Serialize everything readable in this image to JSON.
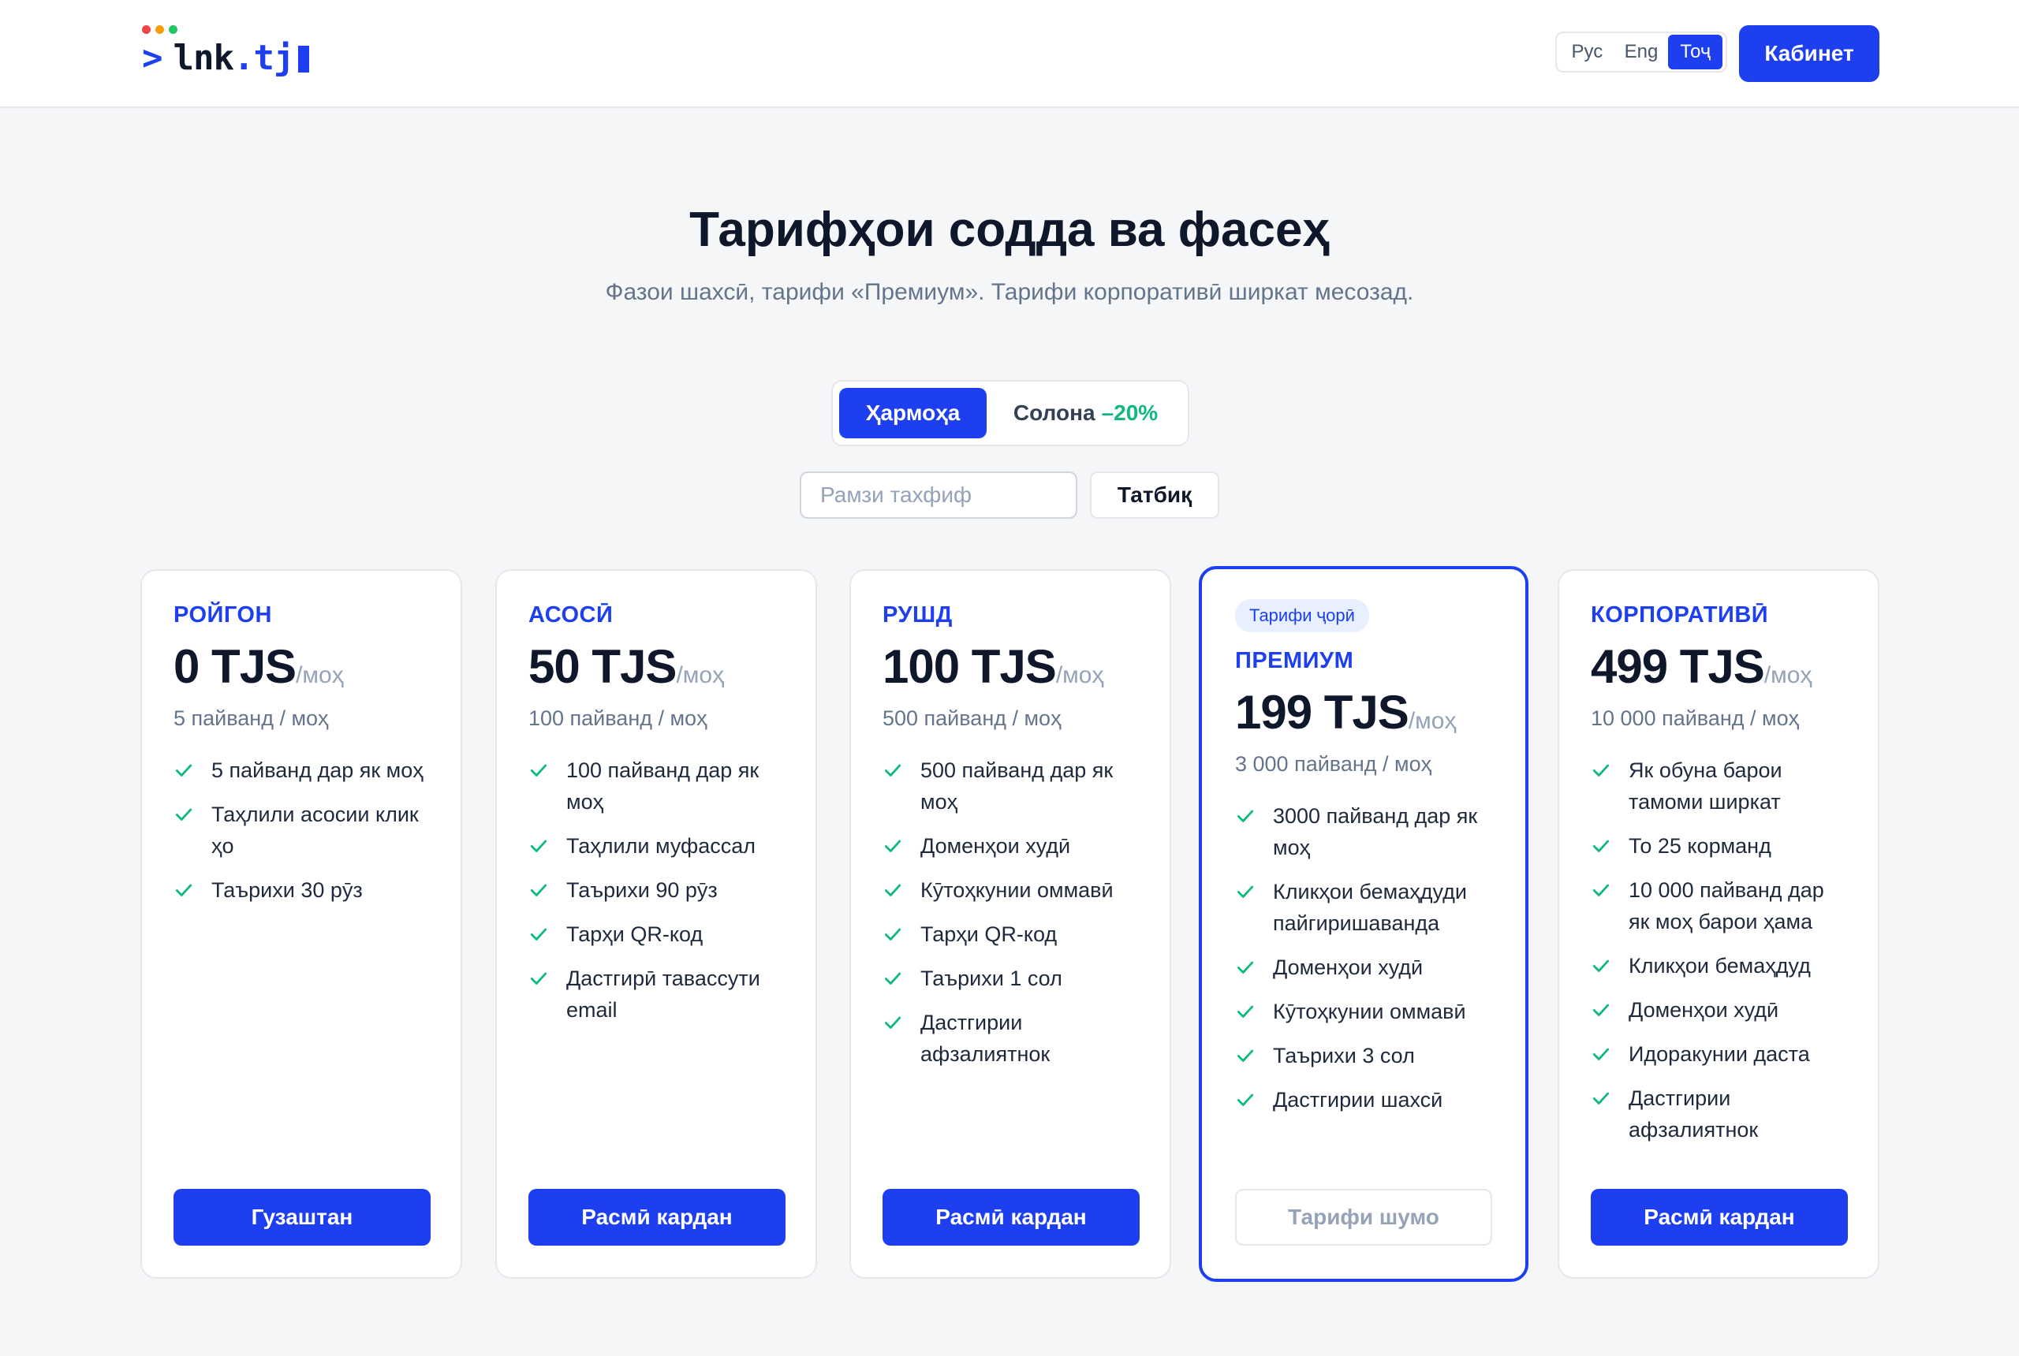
{
  "header": {
    "logo": {
      "prompt": ">",
      "name": "lnk",
      "dot": ".",
      "tld": "tj"
    },
    "languages": [
      {
        "label": "Рус",
        "active": false
      },
      {
        "label": "Eng",
        "active": false
      },
      {
        "label": "Тоҷ",
        "active": true
      }
    ],
    "cabinet_label": "Кабинет"
  },
  "hero": {
    "title": "Тарифҳои содда ва фасеҳ",
    "subtitle": "Фазои шахсӣ, тарифи «Премиум». Тарифи корпоративӣ ширкат месозад."
  },
  "billing": {
    "monthly_label": "Ҳармоҳа",
    "yearly_label": "Солона",
    "yearly_discount": "–20%"
  },
  "promo": {
    "placeholder": "Рамзи тахфиф",
    "apply_label": "Татбиқ"
  },
  "plans": [
    {
      "name": "РОЙГОН",
      "price": "0 TJS",
      "per": "/моҳ",
      "links": "5 пайванд / моҳ",
      "features": [
        "5 пайванд дар як моҳ",
        "Таҳлили асосии клик​ҳо",
        "Таърихи 30 рӯз"
      ],
      "button": "Гузаштан"
    },
    {
      "name": "АСОСӢ",
      "price": "50 TJS",
      "per": "/моҳ",
      "links": "100 пайванд / моҳ",
      "features": [
        "100 пайванд дар як моҳ",
        "Таҳлили муфассал",
        "Таърихи 90 рӯз",
        "Тарҳи QR-код",
        "Дастгирӣ тавассути email"
      ],
      "button": "Расмӣ кардан"
    },
    {
      "name": "РУШД",
      "price": "100 TJS",
      "per": "/моҳ",
      "links": "500 пайванд / моҳ",
      "features": [
        "500 пайванд дар як моҳ",
        "Доменҳои худӣ",
        "Кӯтоҳкунии оммавӣ",
        "Тарҳи QR-код",
        "Таърихи 1 сол",
        "Дастгирии афзалиятнок"
      ],
      "button": "Расмӣ кардан"
    },
    {
      "badge": "Тарифи ҷорӣ",
      "name": "ПРЕМИУМ",
      "price": "199 TJS",
      "per": "/моҳ",
      "links": "3 000 пайванд / моҳ",
      "features": [
        "3000 пайванд дар як моҳ",
        "Клик​ҳои бемаҳдуди пайгиришаванда",
        "Доменҳои худӣ",
        "Кӯтоҳкунии оммавӣ",
        "Таърихи 3 сол",
        "Дастгирии шахсӣ"
      ],
      "button": "Тарифи шумо"
    },
    {
      "name": "КОРПОРАТИВӢ",
      "price": "499 TJS",
      "per": "/моҳ",
      "links": "10 000 пайванд / моҳ",
      "features": [
        "Як обуна барои тамоми ширкат",
        "То 25 корманд",
        "10 000 пайванд дар як моҳ барои ҳама",
        "Клик​ҳои бемаҳдуд",
        "Доменҳои худӣ",
        "Идоракунии даста",
        "Дастгирии афзалиятнок"
      ],
      "button": "Расмӣ кардан"
    }
  ],
  "colors": {
    "accent": "#1d3ff0",
    "discount": "#10b981",
    "check": "#10b981",
    "logo_dots": [
      "#ef4444",
      "#f59e0b",
      "#22c55e"
    ]
  }
}
